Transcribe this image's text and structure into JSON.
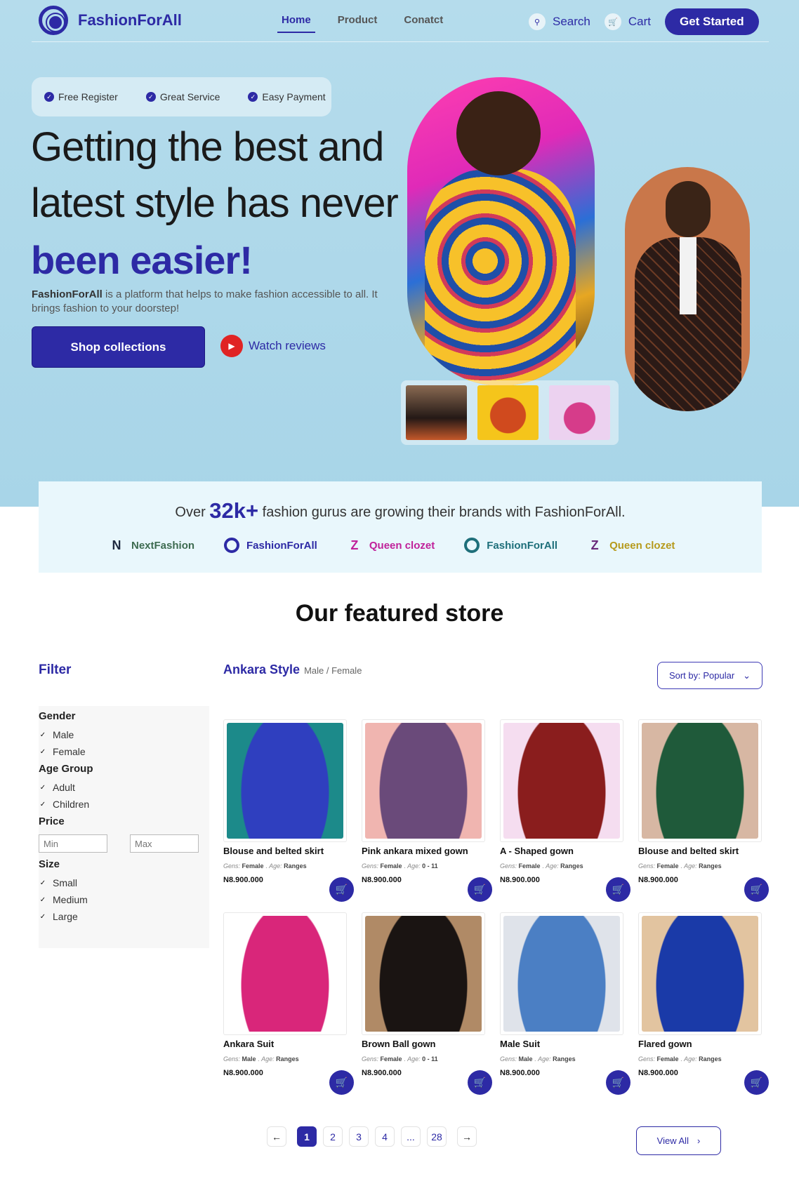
{
  "nav": {
    "brand": "FashionForAll",
    "links": [
      "Home",
      "Product",
      "Conatct"
    ],
    "search_label": "Search",
    "cart_label": "Cart",
    "cta": "Get Started"
  },
  "hero": {
    "badges": [
      "Free Register",
      "Great Service",
      "Easy Payment"
    ],
    "headline_line1": "Getting the best and",
    "headline_line2": "latest style has never",
    "headline_emphasis": "been easier!",
    "lead_brand": "FashionForAll",
    "lead_text": " is a platform that helps to make fashion accessible to all. It brings fashion to your doorstep!",
    "shop_button": "Shop collections",
    "watch_label": "Watch reviews"
  },
  "gurus": {
    "prefix": "Over ",
    "count": "32k+",
    "suffix": " fashion gurus are growing their brands with FashionForAll.",
    "brands": [
      {
        "name": "NextFashion",
        "color": "#3d6b50",
        "mark": "N"
      },
      {
        "name": "FashionForAll",
        "color": "#2d2aa5",
        "mark": "ring"
      },
      {
        "name": "Queen clozet",
        "color": "#c0219a",
        "mark": "Z"
      },
      {
        "name": "FashionForAll",
        "color": "#1e6f7a",
        "mark": "ring"
      },
      {
        "name": "Queen clozet",
        "color": "#b69a1c",
        "mark": "Z"
      }
    ]
  },
  "store": {
    "title": "Our featured store",
    "filter_title": "Filter",
    "category": "Ankara Style",
    "category_sub": "Male / Female",
    "sort_label": "Sort by: Popular",
    "filters": {
      "gender_title": "Gender",
      "gender": [
        "Male",
        "Female"
      ],
      "age_title": "Age Group",
      "age": [
        "Adult",
        "Children"
      ],
      "price_title": "Price",
      "min_placeholder": "Min",
      "max_placeholder": "Max",
      "size_title": "Size",
      "size": [
        "Small",
        "Medium",
        "Large"
      ]
    },
    "gens_label": "Gens:",
    "age_label": "Age:",
    "products": [
      {
        "name": "Blouse and belted skirt",
        "gens": "Female",
        "age": "Ranges",
        "price": "N8.900.000",
        "c1": "#1c8a8a",
        "c2": "#2f3fbf"
      },
      {
        "name": "Pink ankara mixed gown",
        "gens": "Female",
        "age": "0 - 11",
        "price": "N8.900.000",
        "c1": "#f0b5b0",
        "c2": "#6a4a7a"
      },
      {
        "name": "A - Shaped gown",
        "gens": "Female",
        "age": "Ranges",
        "price": "N8.900.000",
        "c1": "#f5ddf0",
        "c2": "#8a1d1d"
      },
      {
        "name": "Blouse and belted skirt",
        "gens": "Female",
        "age": "Ranges",
        "price": "N8.900.000",
        "c1": "#d7b7a3",
        "c2": "#1f5a3a"
      },
      {
        "name": "Ankara Suit",
        "gens": "Male",
        "age": "Ranges",
        "price": "N8.900.000",
        "c1": "#ffffff",
        "c2": "#d9267a"
      },
      {
        "name": "Brown Ball gown",
        "gens": "Female",
        "age": "0 - 11",
        "price": "N8.900.000",
        "c1": "#b08a66",
        "c2": "#1a1412"
      },
      {
        "name": "Male Suit",
        "gens": "Male",
        "age": "Ranges",
        "price": "N8.900.000",
        "c1": "#dfe3ea",
        "c2": "#4b7fc4"
      },
      {
        "name": "Flared gown",
        "gens": "Female",
        "age": "Ranges",
        "price": "N8.900.000",
        "c1": "#e2c4a0",
        "c2": "#1a3aa8"
      }
    ],
    "pagination": [
      "1",
      "2",
      "3",
      "4",
      "...",
      "28"
    ],
    "view_all": "View All"
  },
  "colors": {
    "accent": "#2d2aa5",
    "hero_bg": "#a8d5e8",
    "play": "#e02424"
  }
}
